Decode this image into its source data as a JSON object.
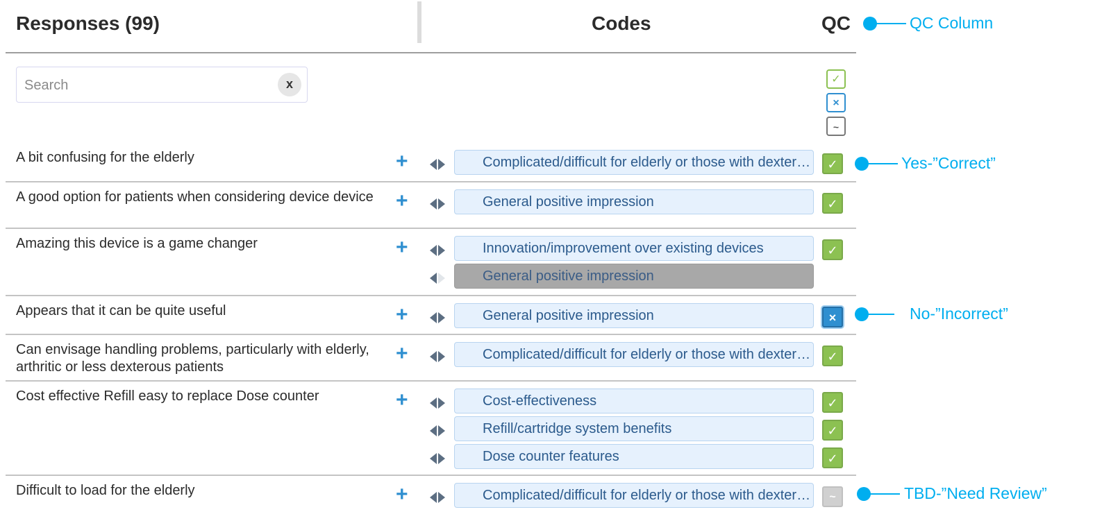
{
  "header": {
    "responses_title": "Responses (99)",
    "codes_title": "Codes",
    "qc_title": "QC"
  },
  "search": {
    "placeholder": "Search",
    "clear_label": "x"
  },
  "qc_filters": {
    "yes_symbol": "✓",
    "no_symbol": "×",
    "tbd_symbol": "~"
  },
  "add_label": "+",
  "rows": [
    {
      "text": "A bit confusing for the elderly",
      "codes": [
        {
          "label": "Complicated/difficult for elderly or those with dexterity issues",
          "qc": "yes",
          "qc_symbol": "✓"
        }
      ]
    },
    {
      "text": "A good option for patients when considering device device",
      "codes": [
        {
          "label": "General positive impression",
          "qc": "yes",
          "qc_symbol": "✓"
        }
      ]
    },
    {
      "text": "Amazing this device is a game changer",
      "codes": [
        {
          "label": "Innovation/improvement over existing devices",
          "qc": "yes",
          "qc_symbol": "✓"
        },
        {
          "label": "General positive impression",
          "qc": "none",
          "state": "disabled"
        }
      ]
    },
    {
      "text": "Appears that it can be quite useful",
      "codes": [
        {
          "label": "General positive impression",
          "qc": "no",
          "qc_symbol": "×"
        }
      ]
    },
    {
      "text": "Can envisage handling problems, particularly with elderly, arthritic or less dexterous patients",
      "codes": [
        {
          "label": "Complicated/difficult for elderly or those with dexterity issues",
          "qc": "yes",
          "qc_symbol": "✓"
        }
      ]
    },
    {
      "text": "Cost effective Refill easy to replace Dose counter",
      "codes": [
        {
          "label": "Cost-effectiveness",
          "qc": "yes",
          "qc_symbol": "✓"
        },
        {
          "label": "Refill/cartridge system benefits",
          "qc": "yes",
          "qc_symbol": "✓"
        },
        {
          "label": "Dose counter features",
          "qc": "yes",
          "qc_symbol": "✓"
        }
      ]
    },
    {
      "text": "Difficult to load for the elderly",
      "codes": [
        {
          "label": "Complicated/difficult for elderly or those with dexterity issues",
          "qc": "tbd",
          "qc_symbol": "~"
        }
      ]
    }
  ],
  "annotations": {
    "qc_column": "QC Column",
    "yes": "Yes-”Correct”",
    "no": "No-”Incorrect”",
    "tbd": "TBD-”Need Review”"
  },
  "colors": {
    "accent_annotation": "#00aeef",
    "qc_yes": "#8cc152",
    "qc_no": "#2f8fd0",
    "qc_tbd": "#d0d0d0",
    "code_pill_bg": "#e6f1fd",
    "code_pill_text": "#2b5a8c"
  }
}
